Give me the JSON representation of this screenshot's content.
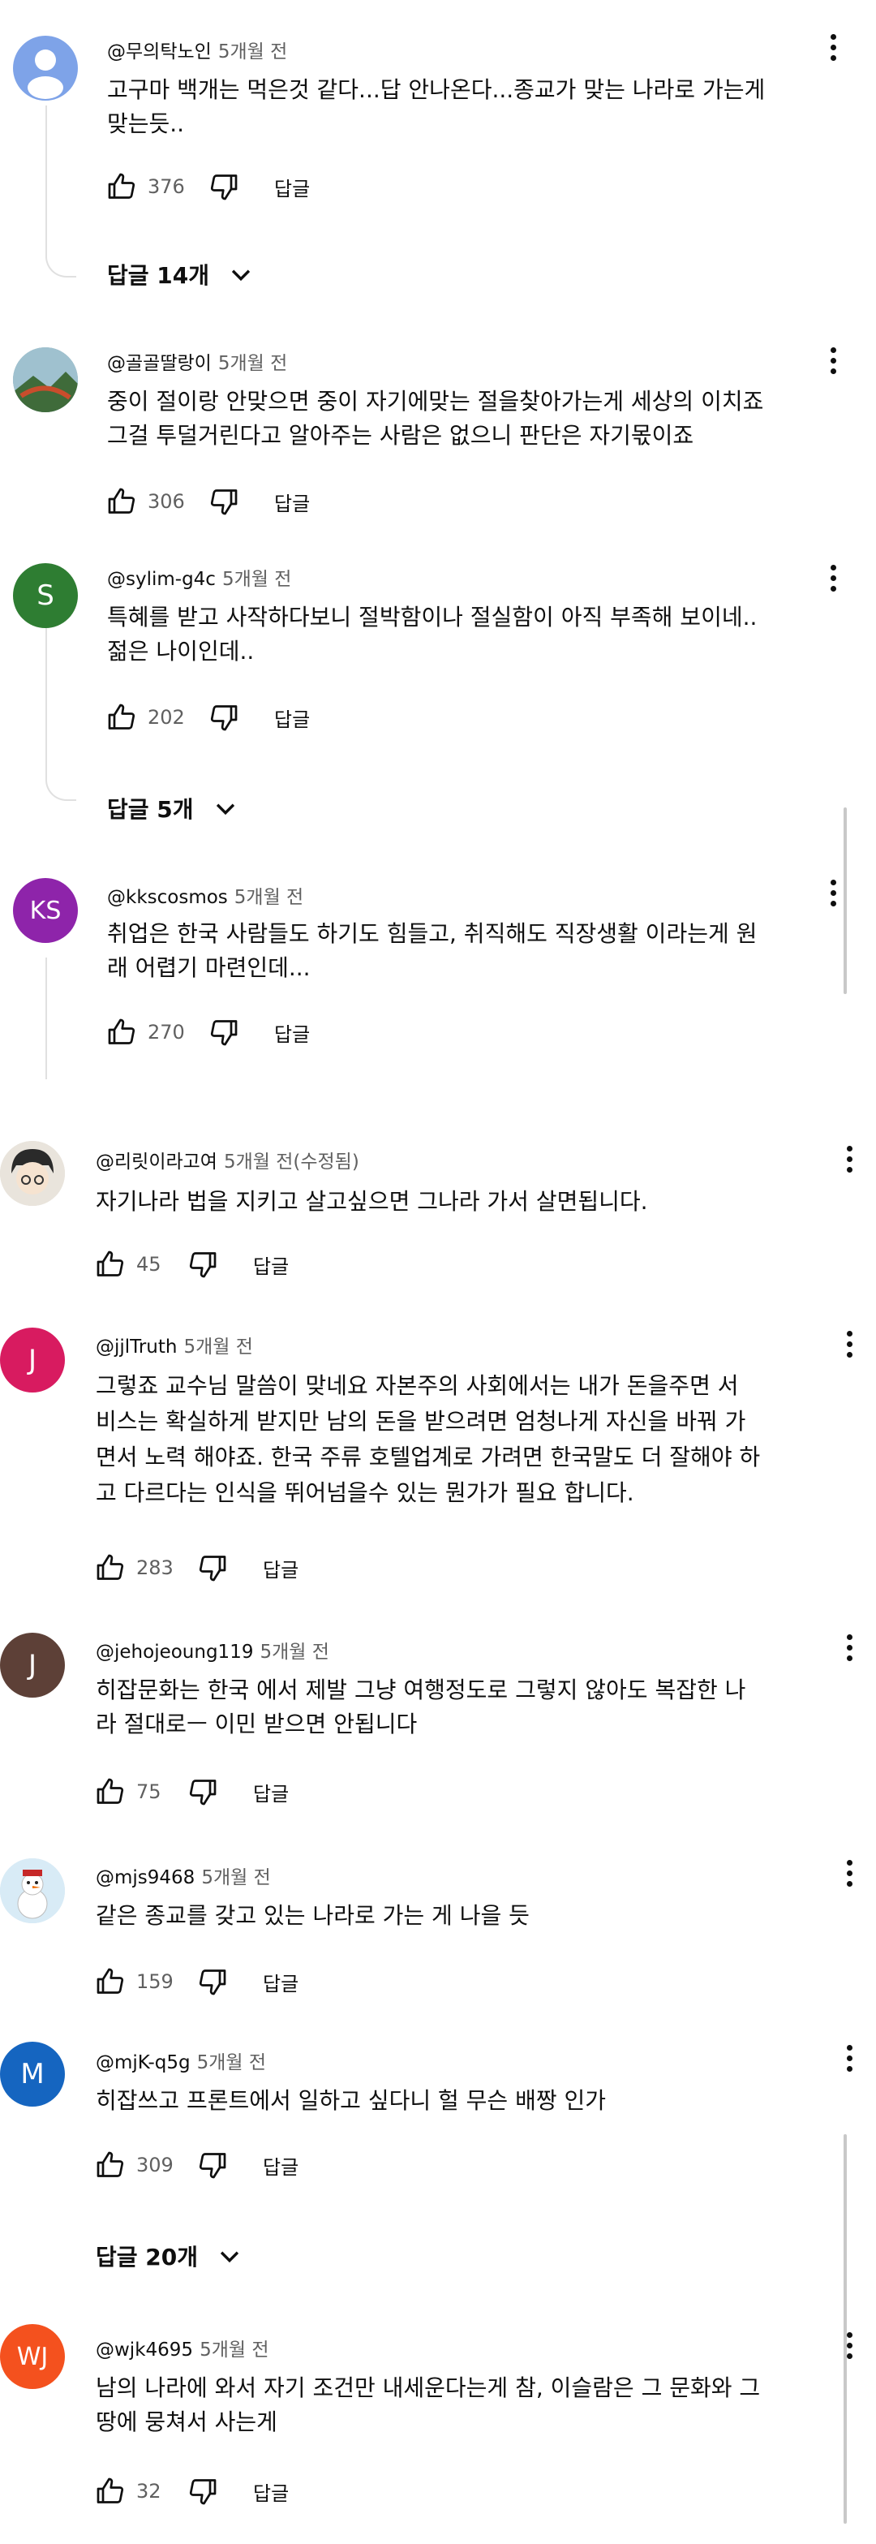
{
  "comments": [
    {
      "handle": "@무의탁노인",
      "time": "5개월 전",
      "lines": [
        "고구마 백개는 먹은것 같다...답 안나온다...종교가 맞는 나라로 가는게",
        "맞는듯.."
      ],
      "likes": "376",
      "reply_label": "답글",
      "avatar_letter": "",
      "avatar_color": "#6b8fd6"
    },
    {
      "handle": "@골골딸랑이",
      "time": "5개월 전",
      "lines": [
        "중이 절이랑 안맞으면 중이 자기에맞는 절을찾아가는게 세상의 이치죠",
        "그걸 투덜거린다고 알아주는 사람은 없으니 판단은 자기몫이죠"
      ],
      "likes": "306",
      "reply_label": "답글",
      "avatar_letter": "",
      "avatar_color": "#5a7a8c"
    },
    {
      "handle": "@sylim-g4c",
      "time": "5개월 전",
      "lines": [
        "특혜를 받고 사작하다보니 절박함이나 절실함이 아직 부족해 보이네..",
        "젊은 나이인데.."
      ],
      "likes": "202",
      "reply_label": "답글",
      "avatar_letter": "S",
      "avatar_color": "#2e7d32"
    },
    {
      "handle": "@kkscosmos",
      "time": "5개월 전",
      "lines": [
        "취업은 한국 사람들도 하기도 힘들고, 취직해도 직장생활 이라는게 원",
        "래 어렵기 마련인데..."
      ],
      "likes": "270",
      "reply_label": "답글",
      "avatar_letter": "KS",
      "avatar_color": "#8e24aa"
    },
    {
      "handle": "@리릿이라고여",
      "time": "5개월 전(수정됨)",
      "lines": [
        "자기나라 법을  지키고 살고싶으면 그나라 가서 살면됩니다."
      ],
      "likes": "45",
      "reply_label": "답글",
      "avatar_letter": "",
      "avatar_color": "#d9d4cc"
    },
    {
      "handle": "@jjlTruth",
      "time": "5개월 전",
      "lines": [
        "그렇죠 교수님 말씀이 맞네요 자본주의 사회에서는 내가 돈을주면 서",
        "비스는 확실하게 받지만 남의 돈을 받으려면 엄청나게 자신을 바꿔 가",
        "면서 노력 해야죠. 한국 주류 호텔업계로 가려면 한국말도 더 잘해야 하",
        "고 다르다는 인식을 뛰어넘을수 있는 뭔가가 필요 합니다."
      ],
      "likes": "283",
      "reply_label": "답글",
      "avatar_letter": "J",
      "avatar_color": "#d81b60"
    },
    {
      "handle": "@jehojeoung119",
      "time": "5개월 전",
      "lines": [
        "히잡문화는 한국 에서 제발 그냥 여행정도로 그렇지 않아도 복잡한 나",
        "라 절대로ㅡ 이민 받으면 안됩니다"
      ],
      "likes": "75",
      "reply_label": "답글",
      "avatar_letter": "J",
      "avatar_color": "#5d4037"
    },
    {
      "handle": "@mjs9468",
      "time": "5개월 전",
      "lines": [
        "같은 종교를 갖고 있는 나라로 가는 게 나을 듯"
      ],
      "likes": "159",
      "reply_label": "답글",
      "avatar_letter": "",
      "avatar_color": "#cfe3f2"
    },
    {
      "handle": "@mjK-q5g",
      "time": "5개월 전",
      "lines": [
        "히잡쓰고 프론트에서 일하고 싶다니 헐 무슨 배짱 인가"
      ],
      "likes": "309",
      "reply_label": "답글",
      "avatar_letter": "M",
      "avatar_color": "#1565c0"
    },
    {
      "handle": "@wjk4695",
      "time": "5개월 전",
      "lines": [
        "남의 나라에 와서 자기 조건만 내세운다는게 참, 이슬람은 그 문화와 그",
        "땅에 뭉쳐서 사는게"
      ],
      "likes": "32",
      "reply_label": "답글",
      "avatar_letter": "WJ",
      "avatar_color": "#f4511e"
    }
  ],
  "reply_toggles": [
    "답글 14개",
    "답글 5개",
    "답글 20개"
  ],
  "icons": {
    "like": "thumb-up-icon",
    "dislike": "thumb-down-icon",
    "more": "more-vert-icon",
    "expand": "chevron-down-icon"
  }
}
